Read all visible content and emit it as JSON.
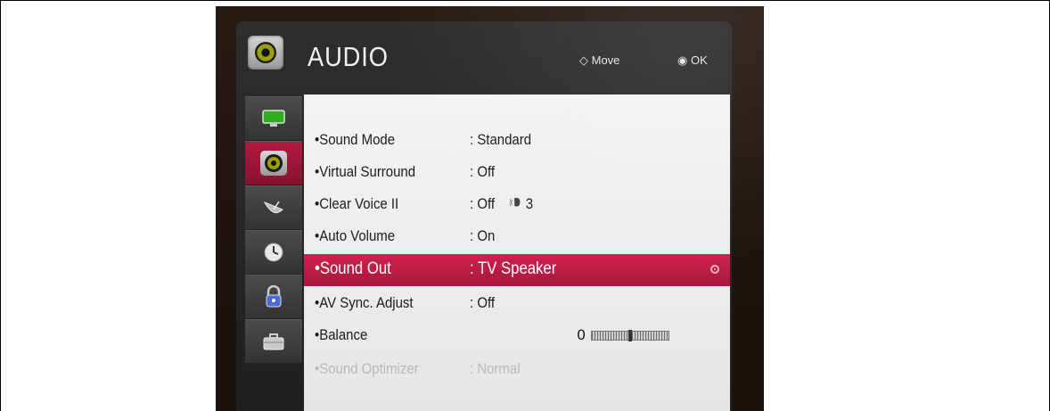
{
  "header": {
    "title": "AUDIO",
    "move_hint": "Move",
    "ok_hint": "OK"
  },
  "sidebar": {
    "items": [
      {
        "icon": "tv-picture-icon"
      },
      {
        "icon": "speaker-icon",
        "active": true
      },
      {
        "icon": "satellite-dish-icon"
      },
      {
        "icon": "clock-icon"
      },
      {
        "icon": "lock-icon"
      },
      {
        "icon": "toolbox-icon"
      }
    ]
  },
  "menu": {
    "items": [
      {
        "label": "Sound Mode",
        "value": ": Standard"
      },
      {
        "label": "Virtual Surround",
        "value": ": Off"
      },
      {
        "label": "Clear Voice II",
        "value": ": Off",
        "extra_value": "3"
      },
      {
        "label": "Auto Volume",
        "value": ": On"
      },
      {
        "label": "Sound Out",
        "value": ": TV Speaker",
        "selected": true
      },
      {
        "label": "AV Sync. Adjust",
        "value": ": Off"
      },
      {
        "label": "Balance",
        "value": "",
        "balance_value": "0",
        "balance_position": 0.5
      },
      {
        "label": "Sound Optimizer",
        "value": ": Normal",
        "dim": true
      }
    ]
  },
  "colors": {
    "accent": "#c01c48",
    "panel": "#efefef",
    "chrome": "#2a2a2a"
  }
}
